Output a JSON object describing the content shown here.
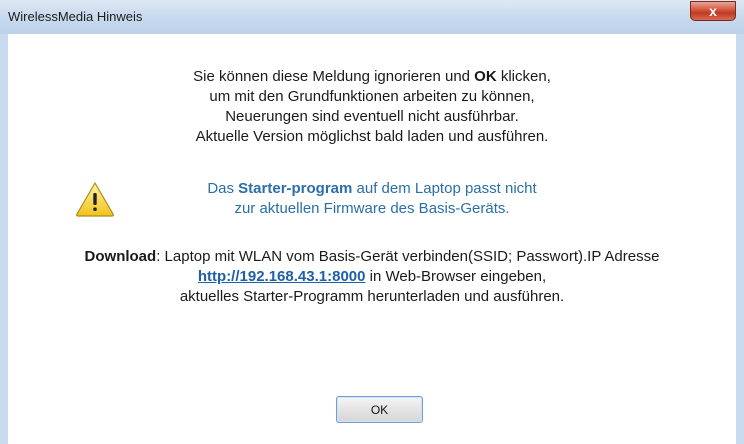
{
  "window": {
    "title": "WirelessMedia Hinweis",
    "close_glyph": "x"
  },
  "message_top": {
    "line1_prefix": "Sie können diese Meldung ignorieren und ",
    "line1_bold": "OK",
    "line1_suffix": " klicken,",
    "line2": "um mit den Grundfunktionen arbeiten zu können,",
    "line3": "Neuerungen sind eventuell nicht ausführbar.",
    "line4": "Aktuelle Version möglichst bald laden und ausführen."
  },
  "warning": {
    "icon": "warning-triangle-icon",
    "line1_prefix": "Das ",
    "line1_bold": "Starter-program",
    "line1_suffix": " auf dem Laptop passt nicht",
    "line2": "zur aktuellen Firmware des Basis-Geräts.",
    "color": "#2a6fa8"
  },
  "download": {
    "label": "Download",
    "line1_rest": ": Laptop mit WLAN vom Basis-Gerät verbinden(SSID; Passwort).IP Adresse",
    "link": "http://192.168.43.1:8000",
    "line2_rest": " in Web-Browser eingeben,",
    "line3": "aktuelles Starter-Programm herunterladen und ausführen."
  },
  "buttons": {
    "ok_label": "OK"
  }
}
